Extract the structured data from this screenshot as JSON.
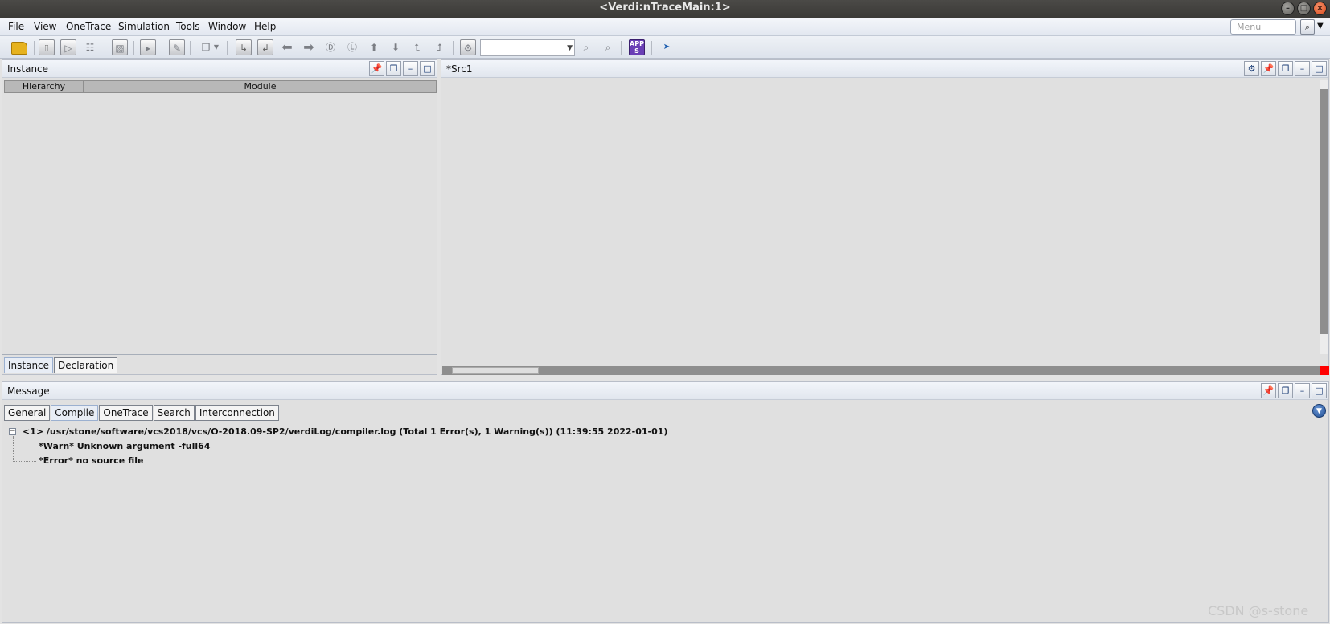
{
  "window": {
    "title": "<Verdi:nTraceMain:1>",
    "buttons": [
      "–",
      "□",
      "×"
    ]
  },
  "menubar": {
    "items": [
      "File",
      "View",
      "OneTrace",
      "Simulation",
      "Tools",
      "Window",
      "Help"
    ],
    "search_placeholder": "Menu"
  },
  "toolbar": {
    "apps_label": "APP S",
    "signal_combo_value": ""
  },
  "instance_panel": {
    "title": "Instance",
    "columns": [
      "Hierarchy",
      "Module"
    ],
    "tabs": [
      "Instance",
      "Declaration"
    ],
    "active_tab": "Instance"
  },
  "source_panel": {
    "title": "*Src1"
  },
  "message_panel": {
    "title": "Message",
    "tabs": [
      "General",
      "Compile",
      "OneTrace",
      "Search",
      "Interconnection"
    ],
    "active_tab": "Compile",
    "log": {
      "header": "<1> /usr/stone/software/vcs2018/vcs/O-2018.09-SP2/verdiLog/compiler.log (Total 1 Error(s), 1 Warning(s)) (11:39:55 2022-01-01)",
      "entries": [
        "*Warn* Unknown argument -full64",
        "*Error* no source file"
      ]
    }
  },
  "watermark": "CSDN @s-stone",
  "colors": {
    "titlebar": "#3d3c39",
    "panel_bg": "#e0e0e0",
    "close_button": "#e2531f",
    "status_red": "#ff0000"
  }
}
